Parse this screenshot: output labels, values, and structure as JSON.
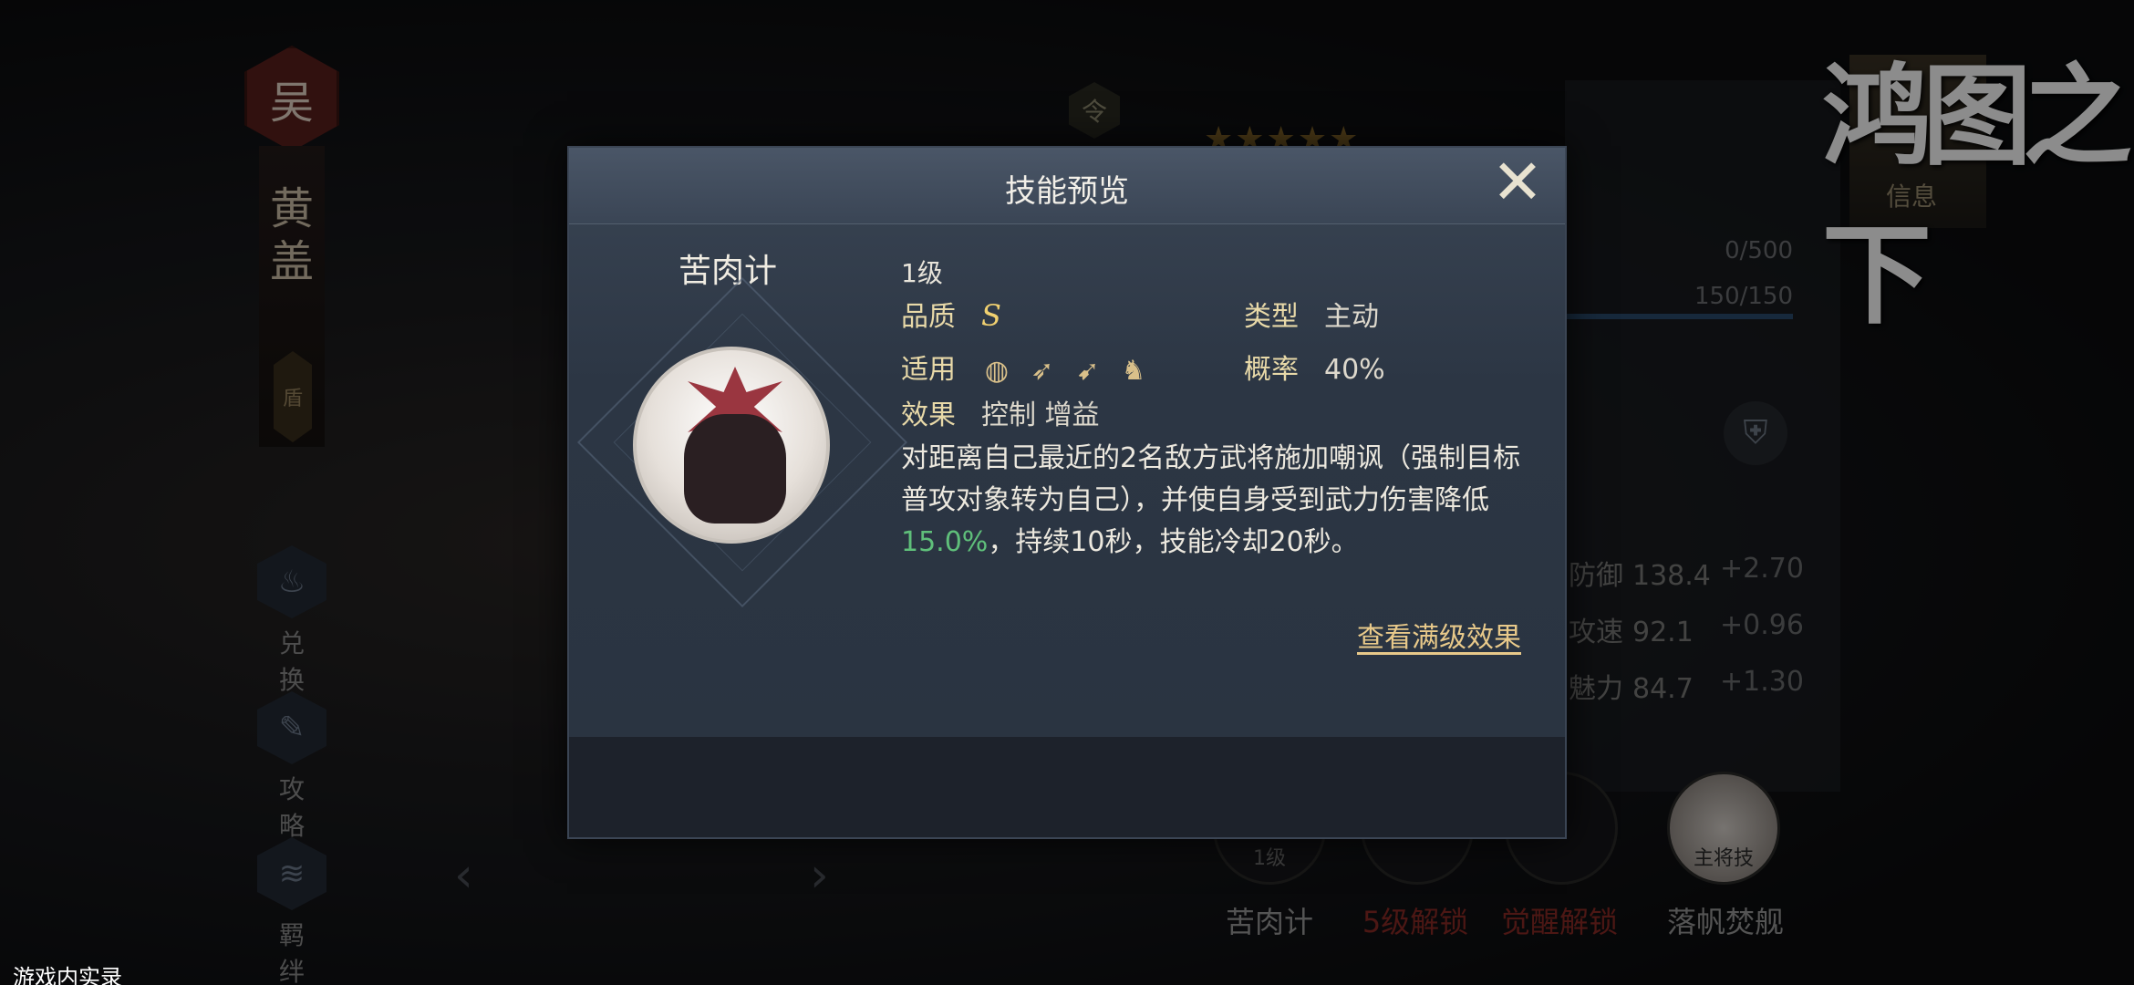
{
  "background": {
    "faction": "吴",
    "hero_name": [
      "黄",
      "盖"
    ],
    "troop_tag": "盾",
    "token": "令",
    "stars": "★★★★★",
    "logo": "鸿图之下",
    "info_tab": "信息",
    "side_buttons": [
      {
        "label": "兑换",
        "icon": "exchange-icon"
      },
      {
        "label": "攻略",
        "icon": "scroll-icon"
      },
      {
        "label": "羁绊",
        "icon": "bond-icon"
      }
    ],
    "bars": [
      "0/500",
      "150/150"
    ],
    "stats": [
      {
        "name": "防御",
        "value": "138.4",
        "delta": "+2.70"
      },
      {
        "name": "攻速",
        "value": "92.1",
        "delta": "+0.96"
      },
      {
        "name": "魅力",
        "value": "84.7",
        "delta": "+1.30"
      }
    ],
    "skill_slots": [
      {
        "label": "苦肉计",
        "tag": "1级",
        "color": "#9a9a9a"
      },
      {
        "label": "5级解锁",
        "tag": "",
        "color": "#8a2a26"
      },
      {
        "label": "觉醒解锁",
        "tag": "",
        "color": "#8a2a26"
      },
      {
        "label": "落帆焚舰",
        "tag": "主将技",
        "color": "#9a9a9a"
      }
    ],
    "footer": "游戏内实录"
  },
  "dialog": {
    "title": "技能预览",
    "skill_name": "苦肉计",
    "level": "1级",
    "quality_label": "品质",
    "quality_value": "S",
    "type_label": "类型",
    "type_value": "主动",
    "apply_label": "适用",
    "apply_icons": [
      "shield-unit-icon",
      "bow-unit-icon",
      "spear-unit-icon",
      "cavalry-unit-icon"
    ],
    "chance_label": "概率",
    "chance_value": "40%",
    "effect_label": "效果",
    "effect_value": "控制 增益",
    "desc_part1": "对距离自己最近的2名敌方武将施加嘲讽（强制目标普攻对象转为自己），并使自身受到武力伤害降低",
    "desc_highlight": "15.0%",
    "desc_part2": "，持续10秒，技能冷却20秒。",
    "full_effect_link": "查看满级效果"
  }
}
